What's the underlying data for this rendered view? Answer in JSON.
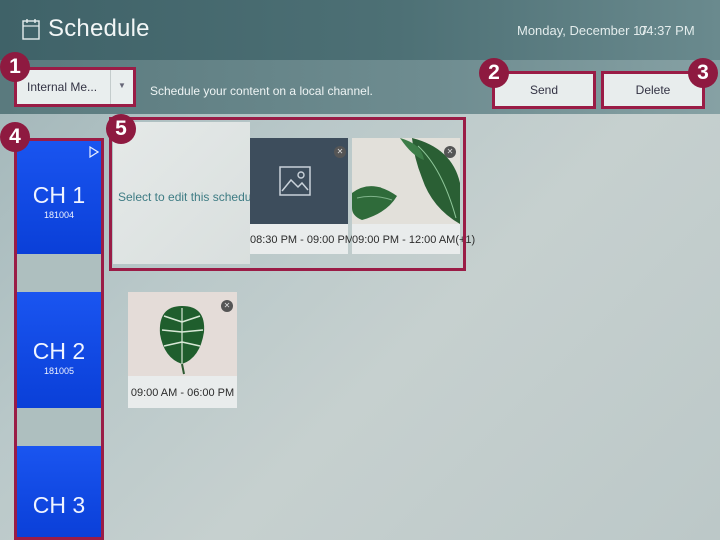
{
  "header": {
    "title": "Schedule",
    "date": "Monday, December 17",
    "time": "04:37 PM"
  },
  "toolbar": {
    "storage_value": "Internal Me...",
    "hint": "Schedule your content on a local channel.",
    "send_label": "Send",
    "delete_label": "Delete"
  },
  "callouts": [
    "1",
    "2",
    "3",
    "4",
    "5"
  ],
  "channels": [
    {
      "name": "CH 1",
      "id": "181004"
    },
    {
      "name": "CH 2",
      "id": "181005"
    },
    {
      "name": "CH 3",
      "id": ""
    }
  ],
  "schedule": {
    "edit_prompt": "Select to edit this schedule",
    "ch1_items": [
      {
        "time": "08:30 PM - 09:00 PM",
        "thumb": "image-placeholder-icon"
      },
      {
        "time": "09:00 PM - 12:00 AM(+1)",
        "thumb": "leaf-photo"
      }
    ],
    "ch2_items": [
      {
        "time": "09:00 AM - 06:00 PM",
        "thumb": "monstera-leaf-photo"
      }
    ]
  },
  "colors": {
    "highlight": "#9a1c46",
    "channel_blue": "#1a55f0",
    "accent_text": "#3e7c84"
  }
}
